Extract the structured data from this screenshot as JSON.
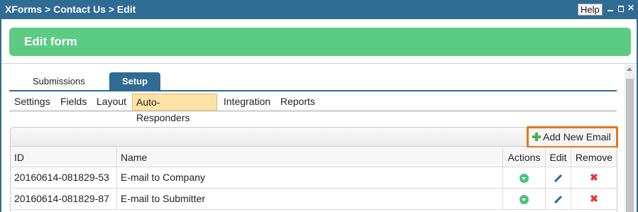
{
  "window": {
    "breadcrumb": "XForms > Contact Us > Edit",
    "help_label": "Help",
    "controls": [
      "minimize-icon",
      "maximize-icon",
      "close-icon"
    ]
  },
  "banner": {
    "title": "Edit form"
  },
  "tabs": [
    {
      "label": "Submissions",
      "active": false
    },
    {
      "label": "Setup",
      "active": true
    }
  ],
  "subnav": [
    {
      "label": "Settings",
      "active": false
    },
    {
      "label": "Fields",
      "active": false
    },
    {
      "label": "Layout",
      "active": false
    },
    {
      "label": "Auto-Responders",
      "active": true
    },
    {
      "label": "Integration",
      "active": false
    },
    {
      "label": "Reports",
      "active": false
    }
  ],
  "toolbar": {
    "add_label": "Add New Email",
    "add_icon": "plus-icon"
  },
  "table": {
    "columns": [
      "ID",
      "Name",
      "Actions",
      "Edit",
      "Remove"
    ],
    "rows": [
      {
        "id": "20160614-081829-53",
        "name": "E-mail to Company"
      },
      {
        "id": "20160614-081829-87",
        "name": "E-mail to Submitter"
      }
    ],
    "row_icons": {
      "actions": "dropdown-icon",
      "edit": "pencil-icon",
      "remove": "remove-icon"
    }
  },
  "colors": {
    "titlebar": "#2f6b93",
    "banner": "#5ccb83",
    "active_subnav": "#fde2a6",
    "highlight_border": "#e8731c",
    "plus": "#4caf50",
    "remove": "#e53935"
  }
}
